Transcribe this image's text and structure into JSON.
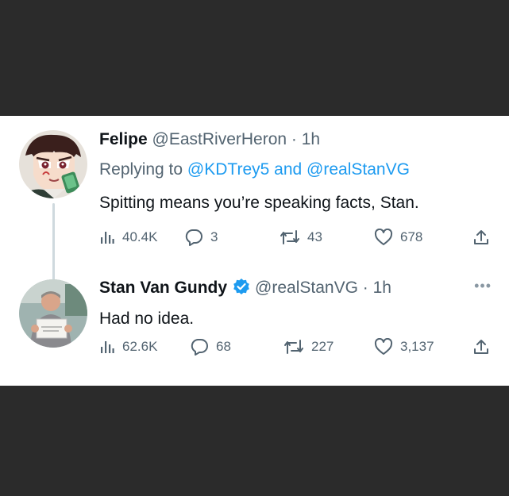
{
  "tweets": [
    {
      "name": "Felipe",
      "handle": "@EastRiverHeron",
      "time": "· 1h",
      "reply_prefix": "Replying to",
      "reply_to_1": "@KDTrey5",
      "reply_and": "and",
      "reply_to_2": "@realStanVG",
      "text": "Spitting means you’re speaking facts, Stan.",
      "views": "40.4K",
      "replies": "3",
      "retweets": "43",
      "likes": "678",
      "avatar": "anime-character-avatar"
    },
    {
      "name": "Stan Van Gundy",
      "verified": true,
      "handle": "@realStanVG",
      "time": "· 1h",
      "more": "•••",
      "text": "Had no idea.",
      "views": "62.6K",
      "replies": "68",
      "retweets": "227",
      "likes": "3,137",
      "avatar": "man-holding-sign-photo"
    }
  ],
  "colors": {
    "background": "#2b2b2b",
    "card": "#ffffff",
    "text": "#0f1419",
    "secondary": "#536471",
    "accent": "#1d9bf0"
  },
  "icons": [
    "views-icon",
    "reply-icon",
    "retweet-icon",
    "like-icon",
    "share-icon",
    "verified-badge-icon",
    "more-icon"
  ]
}
